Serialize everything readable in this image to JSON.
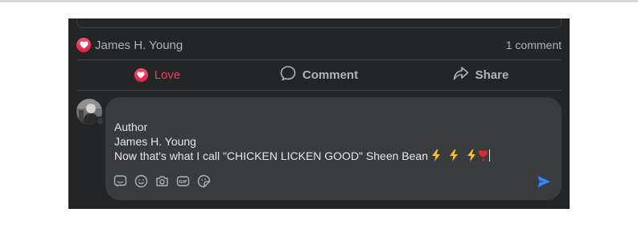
{
  "post": {
    "reactor_name": "James H. Young",
    "comment_count": "1 comment"
  },
  "actions": {
    "love": "Love",
    "comment": "Comment",
    "share": "Share"
  },
  "composer": {
    "author_label": "Author",
    "author_name": "James H. Young",
    "text": "Now that's what I call \"CHICKEN LICKEN GOOD\" Sheen Bean"
  },
  "colors": {
    "background": "#242526",
    "composer": "#3a3b3c",
    "love": "#f33e58",
    "send": "#2d88ff"
  },
  "icons": [
    "heart-icon",
    "comment-icon",
    "share-icon",
    "sticker-icon",
    "emoji-icon",
    "camera-icon",
    "gif-icon",
    "avatar-sticker-icon",
    "send-icon",
    "lightning-emoji",
    "heart-emoji"
  ]
}
